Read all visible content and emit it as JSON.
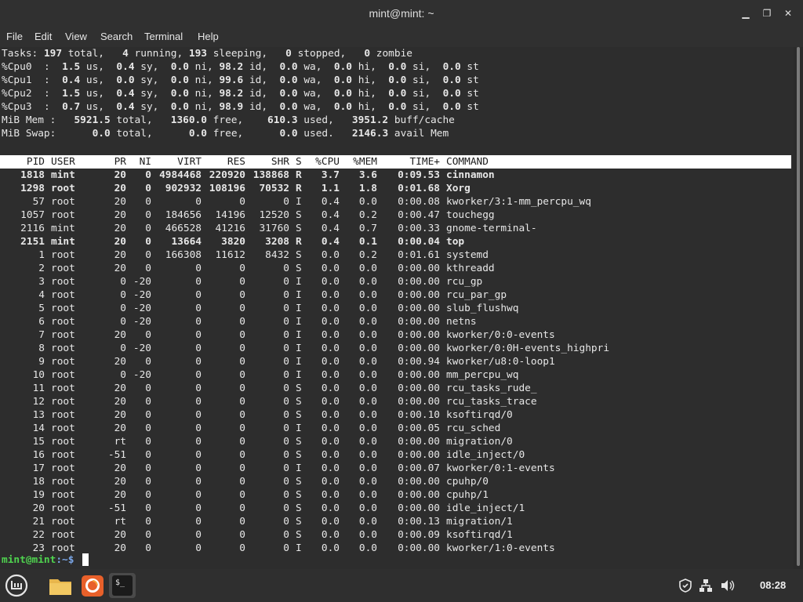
{
  "window": {
    "title": "mint@mint: ~",
    "minimize": "▁",
    "maximize": "❐",
    "close": "✕"
  },
  "menu": [
    "File",
    "Edit",
    "View",
    "Search",
    "Terminal",
    "Help"
  ],
  "summary": {
    "tasks": {
      "total": "197",
      "running": "4",
      "sleeping": "193",
      "stopped": "0",
      "zombie": "0"
    },
    "cpus": [
      {
        "name": "%Cpu0",
        "us": "1.5",
        "sy": "0.4",
        "ni": "0.0",
        "id": "98.2",
        "wa": "0.0",
        "hi": "0.0",
        "si": "0.0",
        "st": "0.0"
      },
      {
        "name": "%Cpu1",
        "us": "0.4",
        "sy": "0.0",
        "ni": "0.0",
        "id": "99.6",
        "wa": "0.0",
        "hi": "0.0",
        "si": "0.0",
        "st": "0.0"
      },
      {
        "name": "%Cpu2",
        "us": "1.5",
        "sy": "0.4",
        "ni": "0.0",
        "id": "98.2",
        "wa": "0.0",
        "hi": "0.0",
        "si": "0.0",
        "st": "0.0"
      },
      {
        "name": "%Cpu3",
        "us": "0.7",
        "sy": "0.4",
        "ni": "0.0",
        "id": "98.9",
        "wa": "0.0",
        "hi": "0.0",
        "si": "0.0",
        "st": "0.0"
      }
    ],
    "mem": {
      "total": "5921.5",
      "free": "1360.0",
      "used": "610.3",
      "buff_cache": "3951.2"
    },
    "swap": {
      "total": "0.0",
      "free": "0.0",
      "used": "0.0",
      "avail": "2146.3"
    }
  },
  "columns": [
    "PID",
    "USER",
    "PR",
    "NI",
    "VIRT",
    "RES",
    "SHR",
    "S",
    "%CPU",
    "%MEM",
    "TIME+",
    "COMMAND"
  ],
  "processes": [
    {
      "pid": "1818",
      "user": "mint",
      "pr": "20",
      "ni": "0",
      "virt": "4984468",
      "res": "220920",
      "shr": "138868",
      "s": "R",
      "cpu": "3.7",
      "mem": "3.6",
      "time": "0:09.53",
      "cmd": "cinnamon",
      "bold": true
    },
    {
      "pid": "1298",
      "user": "root",
      "pr": "20",
      "ni": "0",
      "virt": "902932",
      "res": "108196",
      "shr": "70532",
      "s": "R",
      "cpu": "1.1",
      "mem": "1.8",
      "time": "0:01.68",
      "cmd": "Xorg",
      "bold": true
    },
    {
      "pid": "57",
      "user": "root",
      "pr": "20",
      "ni": "0",
      "virt": "0",
      "res": "0",
      "shr": "0",
      "s": "I",
      "cpu": "0.4",
      "mem": "0.0",
      "time": "0:00.08",
      "cmd": "kworker/3:1-mm_percpu_wq",
      "bold": false
    },
    {
      "pid": "1057",
      "user": "root",
      "pr": "20",
      "ni": "0",
      "virt": "184656",
      "res": "14196",
      "shr": "12520",
      "s": "S",
      "cpu": "0.4",
      "mem": "0.2",
      "time": "0:00.47",
      "cmd": "touchegg",
      "bold": false
    },
    {
      "pid": "2116",
      "user": "mint",
      "pr": "20",
      "ni": "0",
      "virt": "466528",
      "res": "41216",
      "shr": "31760",
      "s": "S",
      "cpu": "0.4",
      "mem": "0.7",
      "time": "0:00.33",
      "cmd": "gnome-terminal-",
      "bold": false
    },
    {
      "pid": "2151",
      "user": "mint",
      "pr": "20",
      "ni": "0",
      "virt": "13664",
      "res": "3820",
      "shr": "3208",
      "s": "R",
      "cpu": "0.4",
      "mem": "0.1",
      "time": "0:00.04",
      "cmd": "top",
      "bold": true
    },
    {
      "pid": "1",
      "user": "root",
      "pr": "20",
      "ni": "0",
      "virt": "166308",
      "res": "11612",
      "shr": "8432",
      "s": "S",
      "cpu": "0.0",
      "mem": "0.2",
      "time": "0:01.61",
      "cmd": "systemd",
      "bold": false
    },
    {
      "pid": "2",
      "user": "root",
      "pr": "20",
      "ni": "0",
      "virt": "0",
      "res": "0",
      "shr": "0",
      "s": "S",
      "cpu": "0.0",
      "mem": "0.0",
      "time": "0:00.00",
      "cmd": "kthreadd",
      "bold": false
    },
    {
      "pid": "3",
      "user": "root",
      "pr": "0",
      "ni": "-20",
      "virt": "0",
      "res": "0",
      "shr": "0",
      "s": "I",
      "cpu": "0.0",
      "mem": "0.0",
      "time": "0:00.00",
      "cmd": "rcu_gp",
      "bold": false
    },
    {
      "pid": "4",
      "user": "root",
      "pr": "0",
      "ni": "-20",
      "virt": "0",
      "res": "0",
      "shr": "0",
      "s": "I",
      "cpu": "0.0",
      "mem": "0.0",
      "time": "0:00.00",
      "cmd": "rcu_par_gp",
      "bold": false
    },
    {
      "pid": "5",
      "user": "root",
      "pr": "0",
      "ni": "-20",
      "virt": "0",
      "res": "0",
      "shr": "0",
      "s": "I",
      "cpu": "0.0",
      "mem": "0.0",
      "time": "0:00.00",
      "cmd": "slub_flushwq",
      "bold": false
    },
    {
      "pid": "6",
      "user": "root",
      "pr": "0",
      "ni": "-20",
      "virt": "0",
      "res": "0",
      "shr": "0",
      "s": "I",
      "cpu": "0.0",
      "mem": "0.0",
      "time": "0:00.00",
      "cmd": "netns",
      "bold": false
    },
    {
      "pid": "7",
      "user": "root",
      "pr": "20",
      "ni": "0",
      "virt": "0",
      "res": "0",
      "shr": "0",
      "s": "I",
      "cpu": "0.0",
      "mem": "0.0",
      "time": "0:00.00",
      "cmd": "kworker/0:0-events",
      "bold": false
    },
    {
      "pid": "8",
      "user": "root",
      "pr": "0",
      "ni": "-20",
      "virt": "0",
      "res": "0",
      "shr": "0",
      "s": "I",
      "cpu": "0.0",
      "mem": "0.0",
      "time": "0:00.00",
      "cmd": "kworker/0:0H-events_highpri",
      "bold": false
    },
    {
      "pid": "9",
      "user": "root",
      "pr": "20",
      "ni": "0",
      "virt": "0",
      "res": "0",
      "shr": "0",
      "s": "I",
      "cpu": "0.0",
      "mem": "0.0",
      "time": "0:00.94",
      "cmd": "kworker/u8:0-loop1",
      "bold": false
    },
    {
      "pid": "10",
      "user": "root",
      "pr": "0",
      "ni": "-20",
      "virt": "0",
      "res": "0",
      "shr": "0",
      "s": "I",
      "cpu": "0.0",
      "mem": "0.0",
      "time": "0:00.00",
      "cmd": "mm_percpu_wq",
      "bold": false
    },
    {
      "pid": "11",
      "user": "root",
      "pr": "20",
      "ni": "0",
      "virt": "0",
      "res": "0",
      "shr": "0",
      "s": "S",
      "cpu": "0.0",
      "mem": "0.0",
      "time": "0:00.00",
      "cmd": "rcu_tasks_rude_",
      "bold": false
    },
    {
      "pid": "12",
      "user": "root",
      "pr": "20",
      "ni": "0",
      "virt": "0",
      "res": "0",
      "shr": "0",
      "s": "S",
      "cpu": "0.0",
      "mem": "0.0",
      "time": "0:00.00",
      "cmd": "rcu_tasks_trace",
      "bold": false
    },
    {
      "pid": "13",
      "user": "root",
      "pr": "20",
      "ni": "0",
      "virt": "0",
      "res": "0",
      "shr": "0",
      "s": "S",
      "cpu": "0.0",
      "mem": "0.0",
      "time": "0:00.10",
      "cmd": "ksoftirqd/0",
      "bold": false
    },
    {
      "pid": "14",
      "user": "root",
      "pr": "20",
      "ni": "0",
      "virt": "0",
      "res": "0",
      "shr": "0",
      "s": "I",
      "cpu": "0.0",
      "mem": "0.0",
      "time": "0:00.05",
      "cmd": "rcu_sched",
      "bold": false
    },
    {
      "pid": "15",
      "user": "root",
      "pr": "rt",
      "ni": "0",
      "virt": "0",
      "res": "0",
      "shr": "0",
      "s": "S",
      "cpu": "0.0",
      "mem": "0.0",
      "time": "0:00.00",
      "cmd": "migration/0",
      "bold": false
    },
    {
      "pid": "16",
      "user": "root",
      "pr": "-51",
      "ni": "0",
      "virt": "0",
      "res": "0",
      "shr": "0",
      "s": "S",
      "cpu": "0.0",
      "mem": "0.0",
      "time": "0:00.00",
      "cmd": "idle_inject/0",
      "bold": false
    },
    {
      "pid": "17",
      "user": "root",
      "pr": "20",
      "ni": "0",
      "virt": "0",
      "res": "0",
      "shr": "0",
      "s": "I",
      "cpu": "0.0",
      "mem": "0.0",
      "time": "0:00.07",
      "cmd": "kworker/0:1-events",
      "bold": false
    },
    {
      "pid": "18",
      "user": "root",
      "pr": "20",
      "ni": "0",
      "virt": "0",
      "res": "0",
      "shr": "0",
      "s": "S",
      "cpu": "0.0",
      "mem": "0.0",
      "time": "0:00.00",
      "cmd": "cpuhp/0",
      "bold": false
    },
    {
      "pid": "19",
      "user": "root",
      "pr": "20",
      "ni": "0",
      "virt": "0",
      "res": "0",
      "shr": "0",
      "s": "S",
      "cpu": "0.0",
      "mem": "0.0",
      "time": "0:00.00",
      "cmd": "cpuhp/1",
      "bold": false
    },
    {
      "pid": "20",
      "user": "root",
      "pr": "-51",
      "ni": "0",
      "virt": "0",
      "res": "0",
      "shr": "0",
      "s": "S",
      "cpu": "0.0",
      "mem": "0.0",
      "time": "0:00.00",
      "cmd": "idle_inject/1",
      "bold": false
    },
    {
      "pid": "21",
      "user": "root",
      "pr": "rt",
      "ni": "0",
      "virt": "0",
      "res": "0",
      "shr": "0",
      "s": "S",
      "cpu": "0.0",
      "mem": "0.0",
      "time": "0:00.13",
      "cmd": "migration/1",
      "bold": false
    },
    {
      "pid": "22",
      "user": "root",
      "pr": "20",
      "ni": "0",
      "virt": "0",
      "res": "0",
      "shr": "0",
      "s": "S",
      "cpu": "0.0",
      "mem": "0.0",
      "time": "0:00.09",
      "cmd": "ksoftirqd/1",
      "bold": false
    },
    {
      "pid": "23",
      "user": "root",
      "pr": "20",
      "ni": "0",
      "virt": "0",
      "res": "0",
      "shr": "0",
      "s": "I",
      "cpu": "0.0",
      "mem": "0.0",
      "time": "0:00.00",
      "cmd": "kworker/1:0-events",
      "bold": false
    }
  ],
  "prompt": {
    "user_host": "mint@mint",
    "suffix": ":~$"
  },
  "taskbar": {
    "apps": [
      {
        "name": "mint-menu-icon",
        "color": "#3c3c3c"
      },
      {
        "name": "files-icon",
        "color": "#e8b64c"
      },
      {
        "name": "firefox-icon",
        "color": "#e8602a"
      },
      {
        "name": "terminal-icon",
        "color": "#1b1b1b"
      }
    ],
    "terminal_label": "$_",
    "tray_icons": [
      "update-shield-icon",
      "network-icon",
      "volume-icon"
    ],
    "clock": "08:28"
  }
}
